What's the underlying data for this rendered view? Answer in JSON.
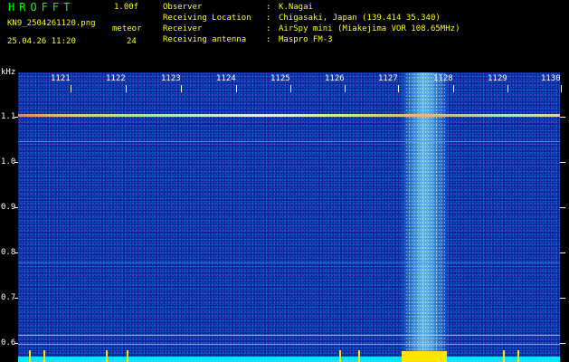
{
  "header": {
    "title": "HROFFT",
    "version": "1.00f",
    "filename": "KN9_2504261120.png",
    "timestamp": "25.04.26 11:20",
    "meteor_label": "meteor",
    "meteor_count": "24",
    "info": [
      {
        "label": "Observer",
        "value": "K.Nagai"
      },
      {
        "label": "Receiving Location",
        "value": "Chigasaki, Japan (139.414 35.340)"
      },
      {
        "label": "Receiver",
        "value": "AirSpy mini (Miakejima VOR 108.65MHz)"
      },
      {
        "label": "Receiving antenna",
        "value": "Maspro FM-3"
      }
    ]
  },
  "waterfall": {
    "unit_label": "kHz",
    "x_ticks": [
      "1121",
      "1122",
      "1123",
      "1124",
      "1125",
      "1126",
      "1127",
      "1128",
      "1129",
      "1130"
    ],
    "y_ticks": [
      "1.1",
      "1.0",
      "0.9",
      "0.8",
      "0.7",
      "0.6"
    ],
    "colors": {
      "background": "#10209a",
      "carrier": "#ffffff",
      "baseline": "#00e8ff",
      "band_peak": "#ffe600"
    }
  }
}
